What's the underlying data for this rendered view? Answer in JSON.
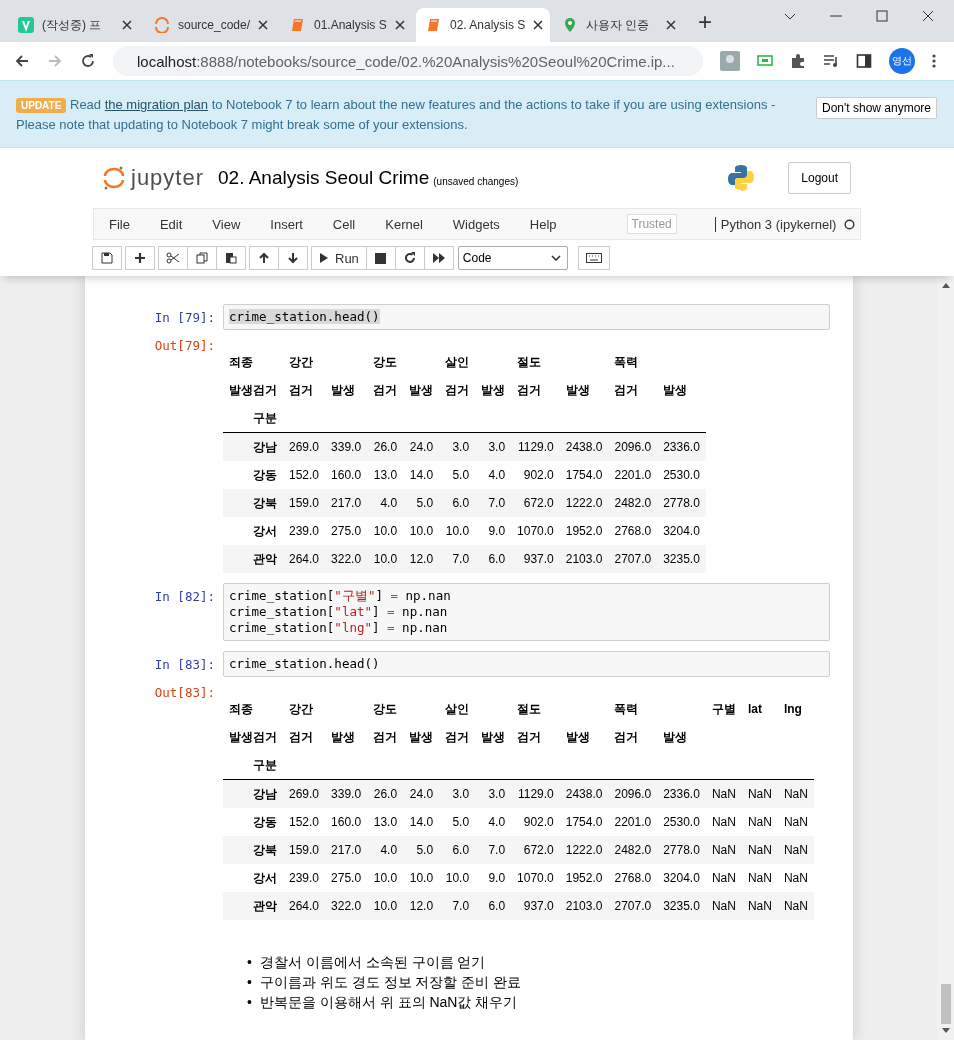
{
  "browser": {
    "tabs": [
      {
        "title": "(작성중) 프",
        "selected": false
      },
      {
        "title": "source_code/",
        "selected": false
      },
      {
        "title": "01.Analysis S",
        "selected": false
      },
      {
        "title": "02. Analysis S",
        "selected": true
      },
      {
        "title": "사용자 인증",
        "selected": false
      }
    ],
    "new_tab": "+",
    "url_host": "localhost",
    "url_rest": ":8888/notebooks/source_code/02.%20Analysis%20Seoul%20Crime.ip...",
    "profile": "영선"
  },
  "banner": {
    "badge": "UPDATE",
    "text_before": "Read",
    "link": "the migration plan",
    "text_after": "to Notebook 7 to learn about the new features and the actions to take if you are using extensions - Please note that updating to Notebook 7 might break some of your extensions.",
    "button": "Don't show anymore"
  },
  "header": {
    "logo": "jupyter",
    "title": "02. Analysis Seoul Crime",
    "status": "(unsaved changes)",
    "logout": "Logout"
  },
  "menu": {
    "items": [
      "File",
      "Edit",
      "View",
      "Insert",
      "Cell",
      "Kernel",
      "Widgets",
      "Help"
    ],
    "trusted": "Trusted",
    "kernel": "Python 3 (ipykernel)"
  },
  "toolbar": {
    "run": "Run",
    "cell_type": "Code"
  },
  "cells": [
    {
      "kind": "code",
      "prompt": "In [79]:",
      "lines": [
        [
          {
            "text": "crime_station.head()",
            "kind": "name"
          }
        ]
      ],
      "highlighted": true,
      "output": {
        "prompt": "Out[79]:",
        "table": {
          "corner": "죄종",
          "subcorner": "발생검거",
          "index_name": "구분",
          "column_groups": [
            {
              "label": "강간",
              "columns": [
                "검거",
                "발생"
              ]
            },
            {
              "label": "강도",
              "columns": [
                "검거",
                "발생"
              ]
            },
            {
              "label": "살인",
              "columns": [
                "검거",
                "발생"
              ]
            },
            {
              "label": "절도",
              "columns": [
                "검거",
                "발생"
              ]
            },
            {
              "label": "폭력",
              "columns": [
                "검거",
                "발생"
              ]
            }
          ],
          "rows": [
            {
              "index": "강남",
              "cells": [
                "269.0",
                "339.0",
                "26.0",
                "24.0",
                "3.0",
                "3.0",
                "1129.0",
                "2438.0",
                "2096.0",
                "2336.0"
              ]
            },
            {
              "index": "강동",
              "cells": [
                "152.0",
                "160.0",
                "13.0",
                "14.0",
                "5.0",
                "4.0",
                "902.0",
                "1754.0",
                "2201.0",
                "2530.0"
              ]
            },
            {
              "index": "강북",
              "cells": [
                "159.0",
                "217.0",
                "4.0",
                "5.0",
                "6.0",
                "7.0",
                "672.0",
                "1222.0",
                "2482.0",
                "2778.0"
              ]
            },
            {
              "index": "강서",
              "cells": [
                "239.0",
                "275.0",
                "10.0",
                "10.0",
                "10.0",
                "9.0",
                "1070.0",
                "1952.0",
                "2768.0",
                "3204.0"
              ]
            },
            {
              "index": "관악",
              "cells": [
                "264.0",
                "322.0",
                "10.0",
                "12.0",
                "7.0",
                "6.0",
                "937.0",
                "2103.0",
                "2707.0",
                "3235.0"
              ]
            }
          ]
        }
      }
    },
    {
      "kind": "code",
      "prompt": "In [82]:",
      "highlighted": false,
      "lines": [
        [
          {
            "text": "crime_station[",
            "kind": "name"
          },
          {
            "text": "\"구별\"",
            "kind": "string"
          },
          {
            "text": "] ",
            "kind": "name"
          },
          {
            "text": "=",
            "kind": "operator"
          },
          {
            "text": " np.nan",
            "kind": "name"
          }
        ],
        [
          {
            "text": "crime_station[",
            "kind": "name"
          },
          {
            "text": "\"lat\"",
            "kind": "string"
          },
          {
            "text": "] ",
            "kind": "name"
          },
          {
            "text": "=",
            "kind": "operator"
          },
          {
            "text": " np.nan",
            "kind": "name"
          }
        ],
        [
          {
            "text": "crime_station[",
            "kind": "name"
          },
          {
            "text": "\"lng\"",
            "kind": "string"
          },
          {
            "text": "] ",
            "kind": "name"
          },
          {
            "text": "=",
            "kind": "operator"
          },
          {
            "text": " np.nan",
            "kind": "name"
          }
        ]
      ]
    },
    {
      "kind": "code",
      "prompt": "In [83]:",
      "highlighted": false,
      "lines": [
        [
          {
            "text": "crime_station.head()",
            "kind": "name"
          }
        ]
      ],
      "output": {
        "prompt": "Out[83]:",
        "table": {
          "corner": "죄종",
          "subcorner": "발생검거",
          "index_name": "구분",
          "column_groups": [
            {
              "label": "강간",
              "columns": [
                "검거",
                "발생"
              ]
            },
            {
              "label": "강도",
              "columns": [
                "검거",
                "발생"
              ]
            },
            {
              "label": "살인",
              "columns": [
                "검거",
                "발생"
              ]
            },
            {
              "label": "절도",
              "columns": [
                "검거",
                "발생"
              ]
            },
            {
              "label": "폭력",
              "columns": [
                "검거",
                "발생"
              ]
            },
            {
              "label": "구별"
            },
            {
              "label": "lat"
            },
            {
              "label": "lng"
            }
          ],
          "rows": [
            {
              "index": "강남",
              "cells": [
                "269.0",
                "339.0",
                "26.0",
                "24.0",
                "3.0",
                "3.0",
                "1129.0",
                "2438.0",
                "2096.0",
                "2336.0",
                "NaN",
                "NaN",
                "NaN"
              ]
            },
            {
              "index": "강동",
              "cells": [
                "152.0",
                "160.0",
                "13.0",
                "14.0",
                "5.0",
                "4.0",
                "902.0",
                "1754.0",
                "2201.0",
                "2530.0",
                "NaN",
                "NaN",
                "NaN"
              ]
            },
            {
              "index": "강북",
              "cells": [
                "159.0",
                "217.0",
                "4.0",
                "5.0",
                "6.0",
                "7.0",
                "672.0",
                "1222.0",
                "2482.0",
                "2778.0",
                "NaN",
                "NaN",
                "NaN"
              ]
            },
            {
              "index": "강서",
              "cells": [
                "239.0",
                "275.0",
                "10.0",
                "10.0",
                "10.0",
                "9.0",
                "1070.0",
                "1952.0",
                "2768.0",
                "3204.0",
                "NaN",
                "NaN",
                "NaN"
              ]
            },
            {
              "index": "관악",
              "cells": [
                "264.0",
                "322.0",
                "10.0",
                "12.0",
                "7.0",
                "6.0",
                "937.0",
                "2103.0",
                "2707.0",
                "3235.0",
                "NaN",
                "NaN",
                "NaN"
              ]
            }
          ]
        }
      }
    },
    {
      "kind": "markdown",
      "marker": "•",
      "bullets": [
        "경찰서 이름에서 소속된 구이름 얻기",
        "구이름과 위도 경도 정보 저장할 준비 완료",
        "반복문을 이용해서 위 표의 NaN값 채우기"
      ]
    }
  ]
}
